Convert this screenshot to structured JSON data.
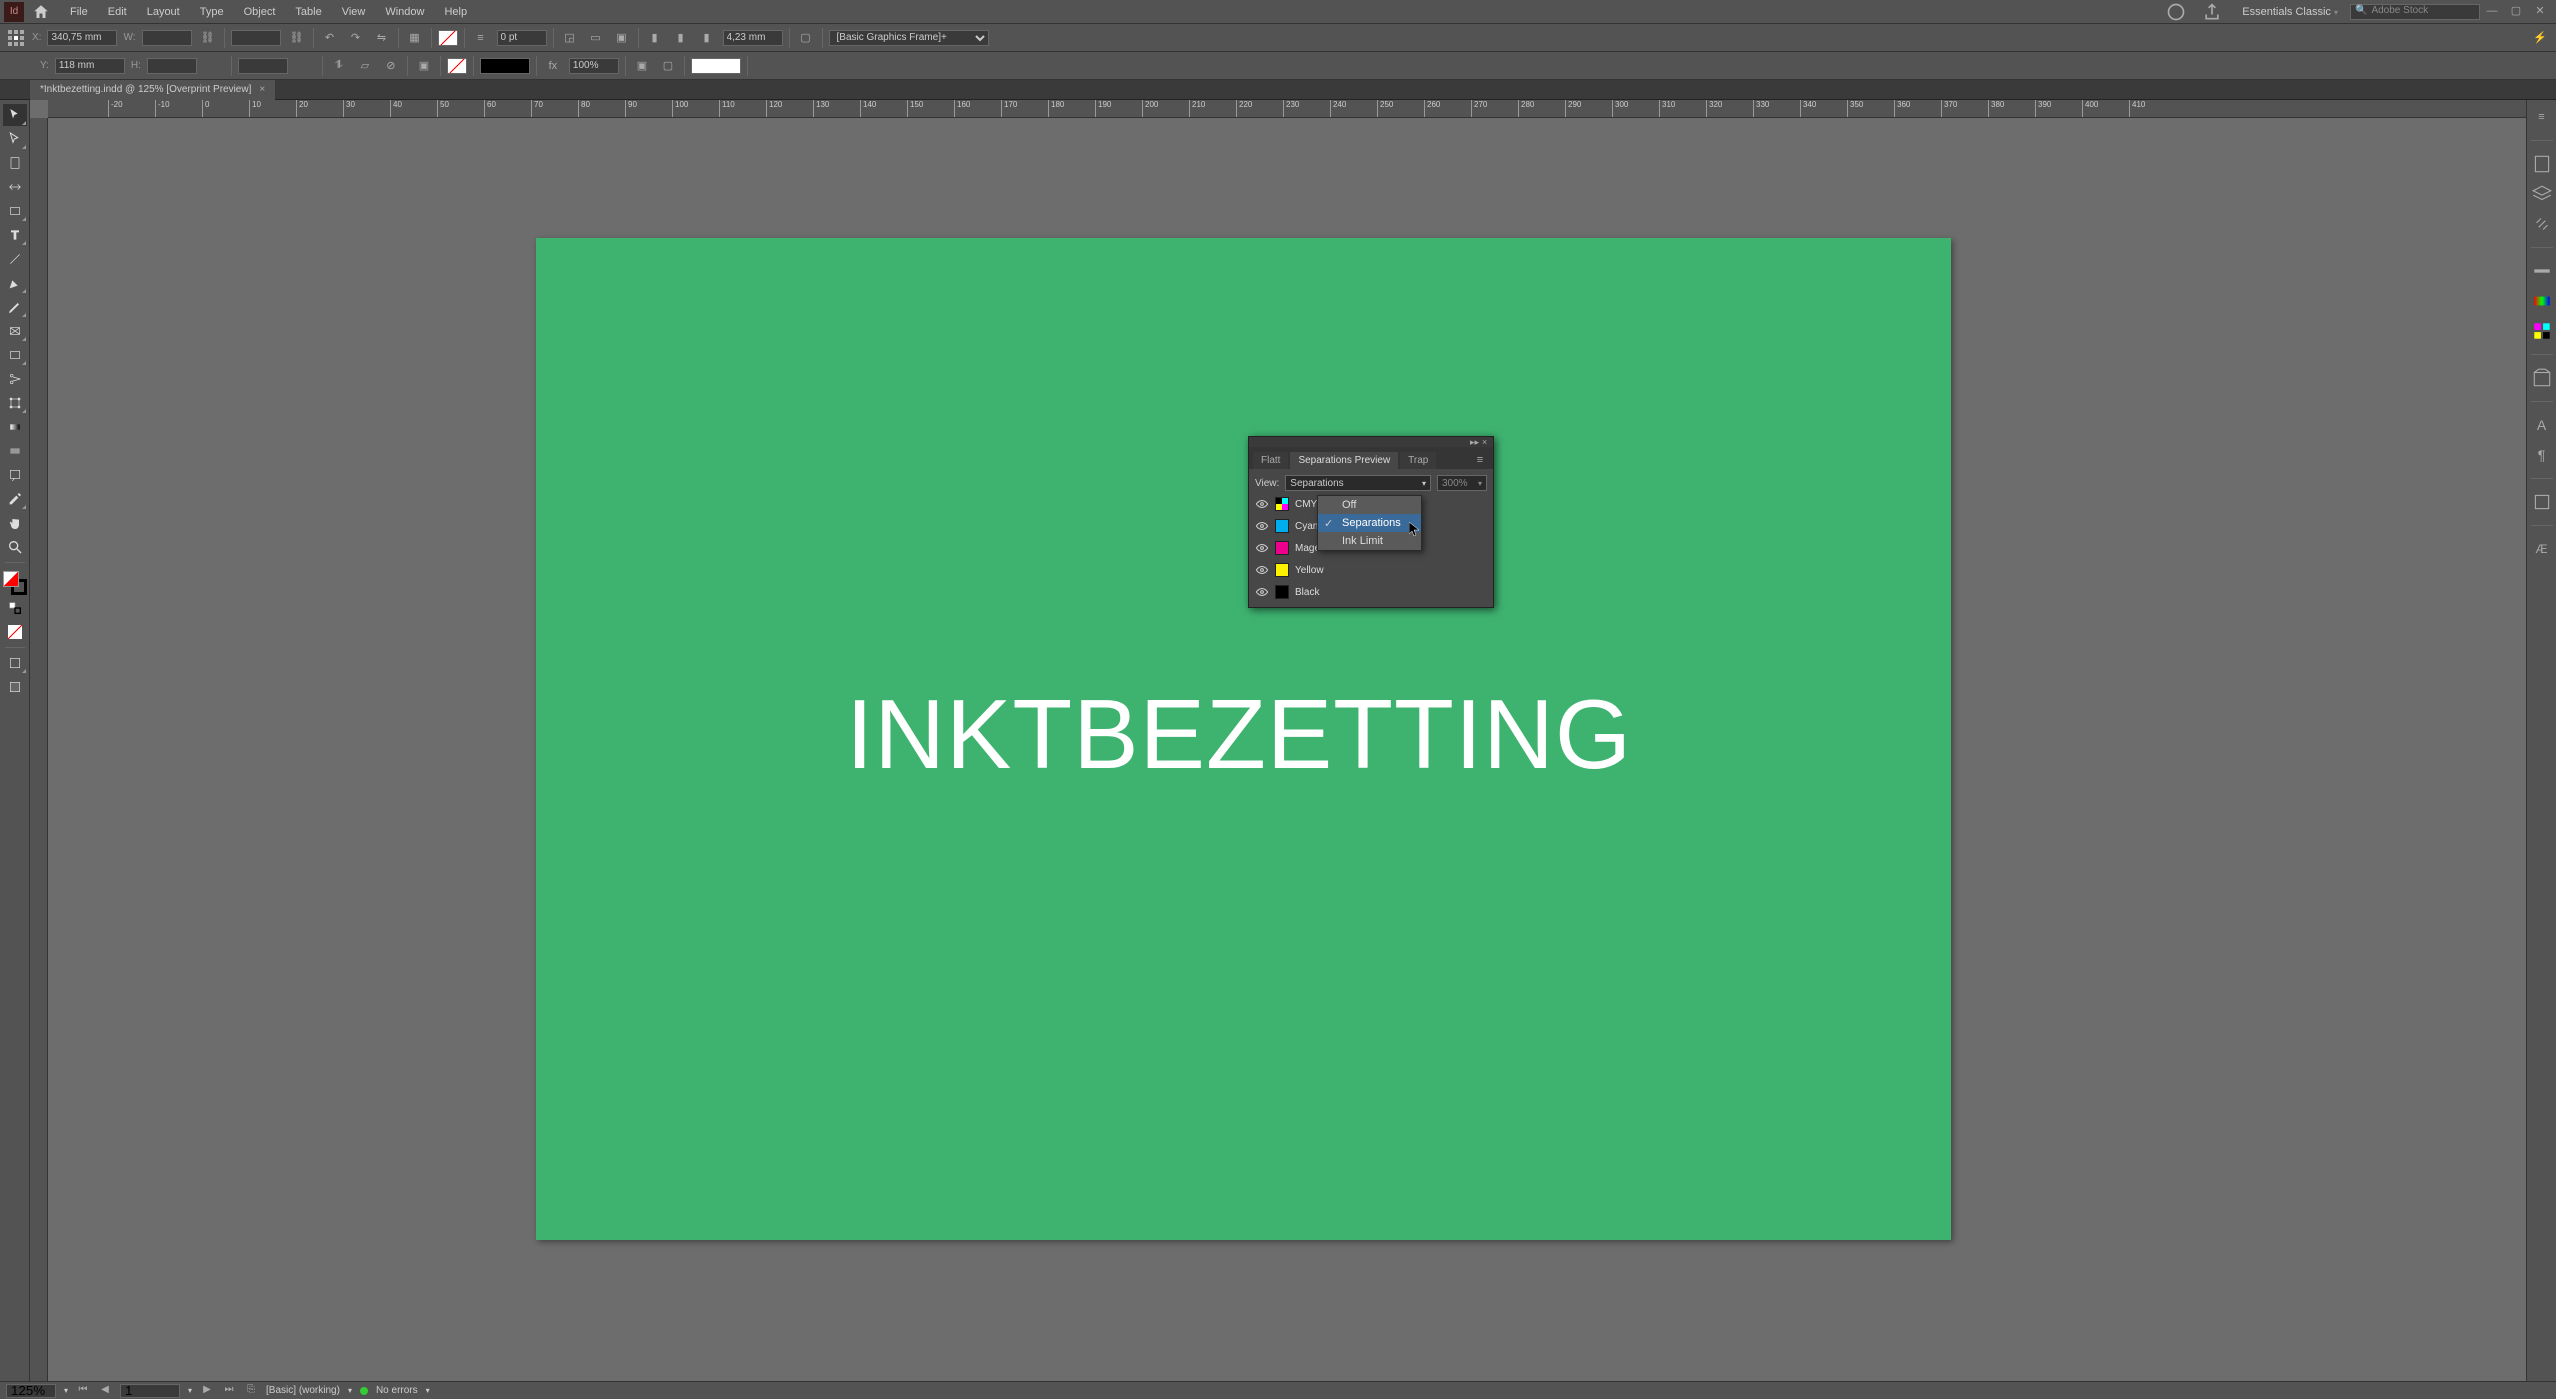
{
  "menu": {
    "items": [
      "File",
      "Edit",
      "Layout",
      "Type",
      "Object",
      "Table",
      "View",
      "Window",
      "Help"
    ],
    "workspace": "Essentials Classic",
    "search_placeholder": "Adobe Stock"
  },
  "ctrl": {
    "x_label": "X:",
    "x_val": "340,75 mm",
    "y_label": "Y:",
    "y_val": "118 mm",
    "w_label": "W:",
    "h_label": "H:",
    "stroke_pt": "0 pt",
    "gap": "4,23 mm",
    "opacity": "100%",
    "frame_style": "[Basic Graphics Frame]+"
  },
  "doc": {
    "tab": "*Inktbezetting.indd @ 125% [Overprint Preview]"
  },
  "ruler": {
    "marks": [
      -20,
      -10,
      0,
      10,
      20,
      30,
      40,
      50,
      60,
      70,
      80,
      90,
      100,
      110,
      120,
      130,
      140,
      150,
      160,
      170,
      180,
      190,
      200,
      210,
      220,
      230,
      240,
      250,
      260,
      270,
      280,
      290,
      300,
      310,
      320,
      330,
      340,
      350,
      360,
      370,
      380,
      390,
      400,
      410
    ]
  },
  "page": {
    "text": "INKTBEZETTING",
    "bg": "#3eb370",
    "text_color": "#ffffff"
  },
  "panel": {
    "tabs": [
      "Flatt",
      "Separations Preview",
      "Trap"
    ],
    "active_tab": 1,
    "view_label": "View:",
    "view_value": "Separations",
    "pct": "300%",
    "inks": [
      {
        "name": "CMYK",
        "color": "#888",
        "is_group": true
      },
      {
        "name": "Cyan",
        "color": "#00AEEF"
      },
      {
        "name": "Magenta",
        "color": "#EC008C"
      },
      {
        "name": "Yellow",
        "color": "#FFF200"
      },
      {
        "name": "Black",
        "color": "#000000"
      }
    ],
    "dropdown": [
      "Off",
      "Separations",
      "Ink Limit"
    ],
    "dropdown_sel": 1
  },
  "status": {
    "zoom": "125%",
    "page": "1",
    "master": "[Basic] (working)",
    "errors": "No errors"
  },
  "chart_data": null
}
